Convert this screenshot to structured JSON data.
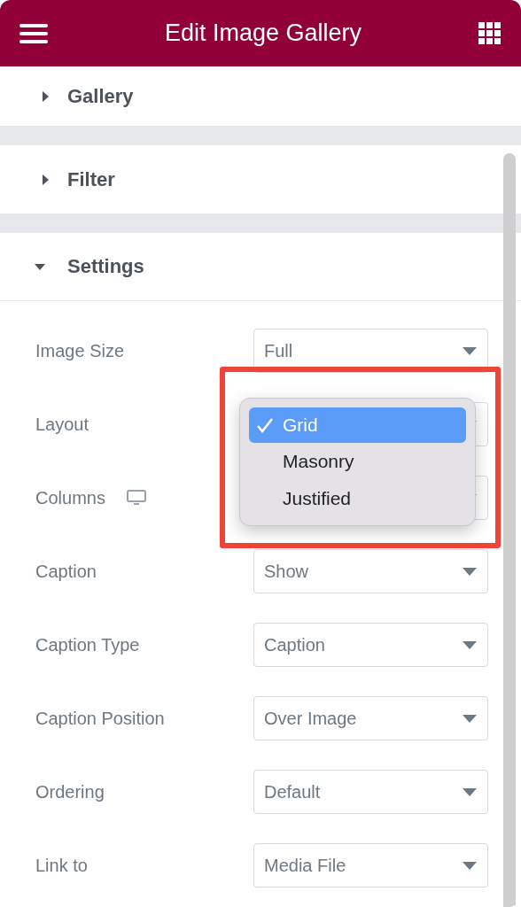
{
  "header": {
    "title": "Edit Image Gallery"
  },
  "sections": [
    {
      "title": "Gallery",
      "expanded": false
    },
    {
      "title": "Filter",
      "expanded": false
    },
    {
      "title": "Settings",
      "expanded": true
    }
  ],
  "fields": [
    {
      "label": "Image Size",
      "kind": "select",
      "value": "Full"
    },
    {
      "label": "Layout",
      "kind": "select"
    },
    {
      "label": "Columns",
      "kind": "select",
      "responsive": true
    },
    {
      "label": "Caption",
      "kind": "select",
      "value": "Show"
    },
    {
      "label": "Caption Type",
      "kind": "select",
      "value": "Caption"
    },
    {
      "label": "Caption Position",
      "kind": "select",
      "value": "Over Image"
    },
    {
      "label": "Ordering",
      "kind": "select",
      "value": "Default"
    },
    {
      "label": "Link to",
      "kind": "select",
      "value": "Media File"
    }
  ],
  "dropdown": {
    "options": [
      {
        "label": "Grid",
        "selected": true
      },
      {
        "label": "Masonry",
        "selected": false
      },
      {
        "label": "Justified",
        "selected": false
      }
    ]
  }
}
